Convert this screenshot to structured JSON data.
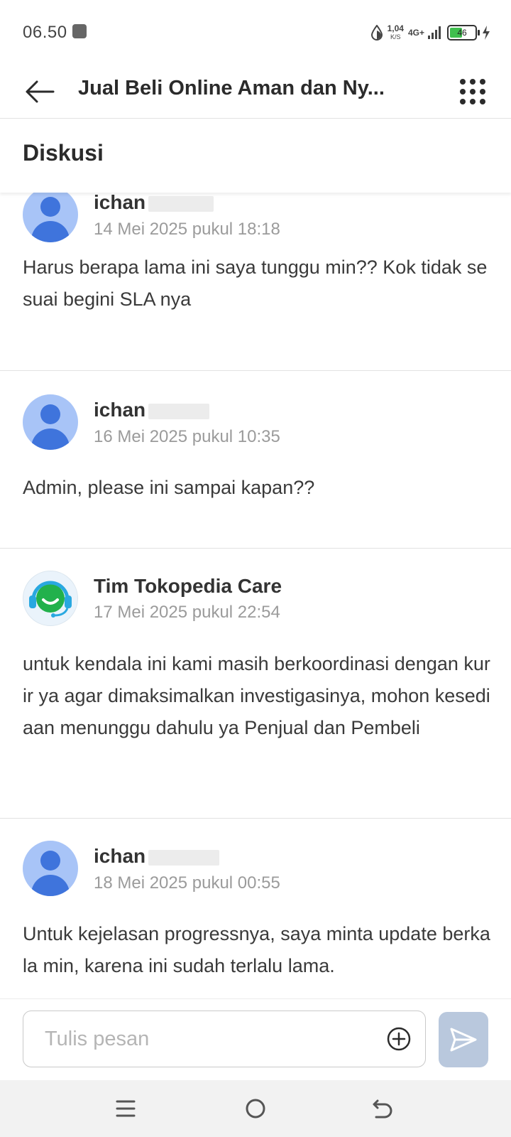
{
  "status_bar": {
    "time": "06.50",
    "net_speed": "1,04",
    "net_speed_unit": "K/S",
    "network": "4G+",
    "battery": "46"
  },
  "header": {
    "title": "Jual Beli Online Aman dan Ny...",
    "section_title": "Diskusi"
  },
  "messages": [
    {
      "author": "ichan",
      "date": "14 Mei 2025 pukul 18:18",
      "text": "Harus berapa lama ini saya tunggu min?? Kok tidak sesuai begini SLA nya"
    },
    {
      "author": "ichan",
      "date": "16 Mei 2025 pukul 10:35",
      "text": "Admin, please ini sampai kapan??"
    },
    {
      "author": "Tim Tokopedia Care",
      "date": "17 Mei 2025 pukul 22:54",
      "text": "untuk kendala ini kami masih berkoordinasi dengan kurir ya agar dimaksimalkan investigasinya, mohon kesediaan menunggu dahulu ya Penjual dan Pembeli"
    },
    {
      "author": "ichan",
      "date": "18 Mei 2025 pukul 00:55",
      "text": "Untuk kejelasan progressnya, saya minta update berkala min, karena ini sudah terlalu lama."
    }
  ],
  "composer": {
    "placeholder": "Tulis pesan"
  },
  "colors": {
    "avatar_bg": "#a8c4f7",
    "avatar_fg": "#3f74dc",
    "care_green": "#22b14c",
    "care_blue": "#29a8e0",
    "send_button": "#b9c8dd"
  }
}
